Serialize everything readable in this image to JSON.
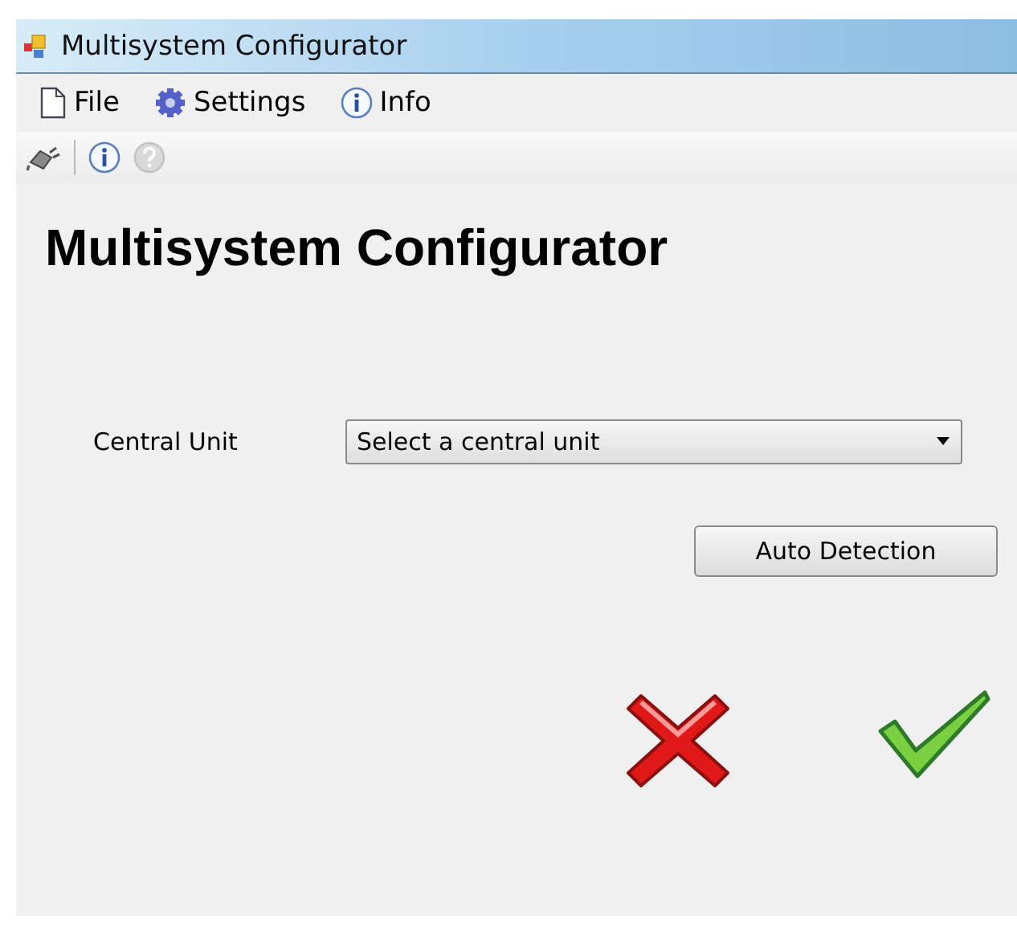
{
  "window": {
    "title": "Multisystem Configurator"
  },
  "menu": [
    {
      "kind": "file",
      "label": "File"
    },
    {
      "kind": "settings",
      "label": "Settings"
    },
    {
      "kind": "info",
      "label": "Info"
    }
  ],
  "toolbar": [
    {
      "kind": "connect",
      "disabled": false
    },
    {
      "kind": "info",
      "disabled": false
    },
    {
      "kind": "help",
      "disabled": true
    }
  ],
  "heading": "Multisystem Configurator",
  "central_unit": {
    "label": "Central Unit",
    "value": "Select a central unit"
  },
  "auto_detection": "Auto Detection",
  "actions": [
    {
      "kind": "cancel"
    },
    {
      "kind": "ok"
    }
  ]
}
